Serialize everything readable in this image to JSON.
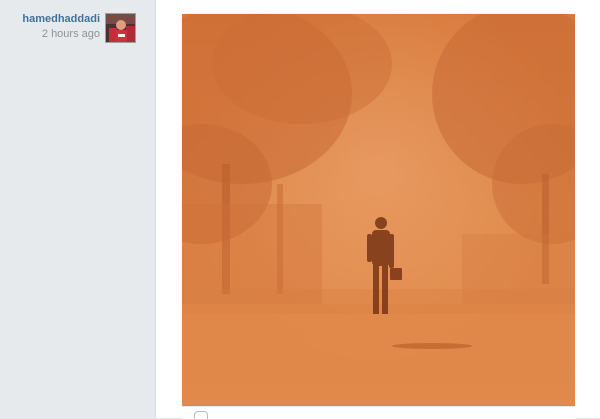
{
  "post": {
    "author": {
      "username": "hamedhaddadi",
      "timestamp": "2 hours ago",
      "avatar_icon": "user-avatar"
    },
    "photo": {
      "dominant_color": "#df8345"
    },
    "actions": {
      "comment_icon": "comment-icon"
    }
  },
  "colors": {
    "username": "#3f729b",
    "timestamp": "#8d9396",
    "background": "#e4e7ea",
    "card": "#ffffff"
  }
}
